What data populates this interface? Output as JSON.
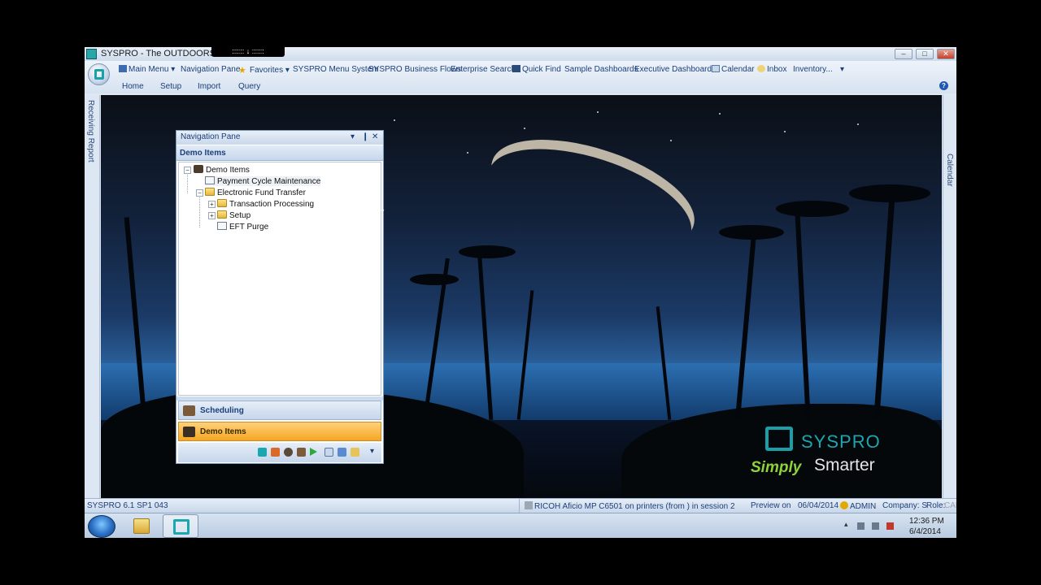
{
  "window": {
    "title": "SYSPRO - The OUTDOORS Com",
    "remote_bar": "::::::  ↓  ::::::",
    "buttons": {
      "minimize": "–",
      "restore": "□",
      "close": "✕"
    }
  },
  "toolbar": {
    "items": [
      {
        "label": "Main Menu",
        "icon": "main-menu-icon",
        "dropdown": "▾"
      },
      {
        "label": "Navigation Pane",
        "icon": ""
      },
      {
        "label": "Favorites",
        "icon": "star-icon",
        "dropdown": "▾"
      },
      {
        "label": "SYSPRO Menu System",
        "icon": ""
      },
      {
        "label": "SYSPRO Business Flows",
        "icon": ""
      },
      {
        "label": "Enterprise Search",
        "icon": ""
      },
      {
        "label": "Quick Find",
        "icon": "binoculars-icon"
      },
      {
        "label": "Sample Dashboards",
        "icon": ""
      },
      {
        "label": "Executive Dashboards",
        "icon": ""
      },
      {
        "label": "Calendar",
        "icon": "calendar-icon"
      },
      {
        "label": "Inbox",
        "icon": "inbox-icon"
      },
      {
        "label": "Inventory...",
        "icon": ""
      }
    ],
    "more": "▾"
  },
  "tabs": [
    "Home",
    "Setup",
    "Import",
    "Query"
  ],
  "help_icon": "?",
  "side_tabs": {
    "left": "Receiving Report",
    "right": "Calendar"
  },
  "nav_pane": {
    "title": "Navigation Pane",
    "controls": {
      "dropdown": "▾",
      "pin": "❙",
      "close": "✕"
    },
    "group": "Demo Items",
    "tree": [
      {
        "label": "Demo Items",
        "icon": "traffic-light-icon",
        "expander": "−"
      },
      {
        "label": "Payment Cycle Maintenance",
        "icon": "edit-icon"
      },
      {
        "label": "Electronic Fund Transfer",
        "icon": "folder-icon",
        "expander": "−"
      },
      {
        "label": "Transaction Processing",
        "icon": "folder-icon",
        "expander": "+"
      },
      {
        "label": "Setup",
        "icon": "folder-icon",
        "expander": "+"
      },
      {
        "label": "EFT Purge",
        "icon": "program-icon"
      }
    ],
    "buttons": [
      {
        "label": "Scheduling",
        "icon": "factory-icon"
      },
      {
        "label": "Demo Items",
        "icon": "traffic-light-icon"
      }
    ],
    "tools_more": "▾"
  },
  "status": {
    "version": "SYSPRO 6.1 SP1 043",
    "printer": "RICOH Aficio MP C6501 on printers (from ) in session 2",
    "preview": "Preview on",
    "date": "06/04/2014",
    "user": "ADMIN",
    "company": "Company: S",
    "role": "Role:",
    "caps": "CAP"
  },
  "taskbar": {
    "time": "12:36 PM",
    "date": "6/4/2014"
  },
  "logo": {
    "syspro": "SYSPRO",
    "simply": "Simply",
    "smarter": "Smarter"
  },
  "colors": {
    "accent": "#1b3f7a",
    "selected_group": "#f5a623",
    "brand_teal": "#1aa7b0",
    "brand_green": "#8dd33a"
  }
}
